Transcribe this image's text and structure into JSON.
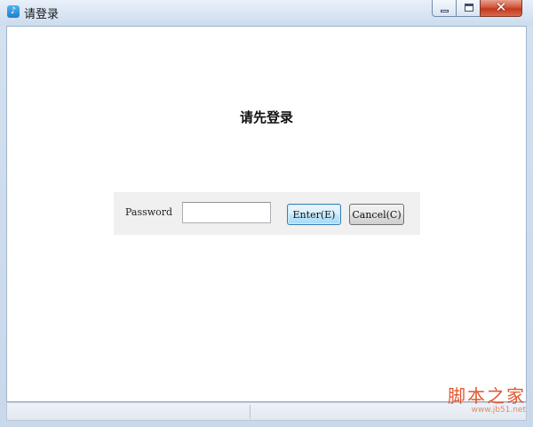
{
  "window": {
    "title": "请登录",
    "app_icon": "app-icon",
    "controls": {
      "minimize_icon": "minimize-icon",
      "maximize_icon": "maximize-icon",
      "close_icon": "close-icon",
      "close_glyph": "✕"
    }
  },
  "main": {
    "heading": "请先登录"
  },
  "login": {
    "password_label": "Password",
    "password_value": "",
    "enter_label": "Enter(E)",
    "cancel_label": "Cancel(C)"
  },
  "watermark": {
    "text": "脚本之家",
    "url": "www.jb51.net"
  },
  "colors": {
    "close_button": "#c3391c",
    "enter_button_border": "#3c7fb1",
    "watermark": "#e0562e"
  }
}
